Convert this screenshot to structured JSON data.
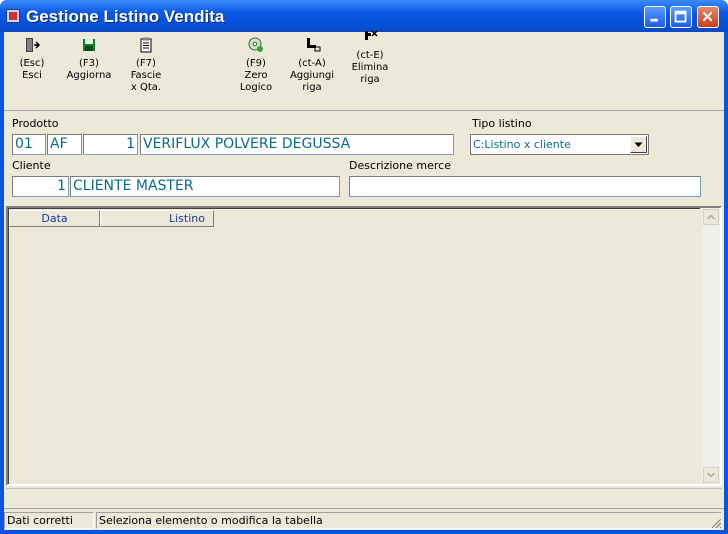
{
  "window": {
    "title": "Gestione Listino Vendita"
  },
  "toolbar": {
    "items": [
      {
        "key": "(Esc)",
        "label": "Esci",
        "icon": "exit-door-icon"
      },
      {
        "key": "(F3)",
        "label": "Aggiorna",
        "icon": "floppy-save-icon"
      },
      {
        "key": "(F7)",
        "label": "Fascie",
        "label2": "x Qta.",
        "icon": "clipboard-icon"
      },
      {
        "key": "(F9)",
        "label": "Zero",
        "label2": "Logico",
        "icon": "cd-icon"
      },
      {
        "key": "(ct-A)",
        "label": "Aggiungi",
        "label2": "riga",
        "icon": "add-row-icon"
      },
      {
        "key": "(ct-E)",
        "label": "Elimina",
        "label2": "riga",
        "icon": "delete-row-icon"
      }
    ]
  },
  "form": {
    "prodotto_label": "Prodotto",
    "prodotto": {
      "code1": "01",
      "code2": "AF",
      "number": "1",
      "description": "VERIFLUX POLVERE DEGUSSA"
    },
    "tipo_listino_label": "Tipo listino",
    "tipo_listino_value": "C:Listino x cliente",
    "cliente_label": "Cliente",
    "cliente": {
      "number": "1",
      "name": "CLIENTE MASTER"
    },
    "descrizione_label": "Descrizione merce",
    "descrizione_value": ""
  },
  "table": {
    "columns": [
      "Data",
      "Listino"
    ]
  },
  "status": {
    "left": "Dati corretti",
    "right": "Seleziona elemento o modifica la tabella"
  }
}
